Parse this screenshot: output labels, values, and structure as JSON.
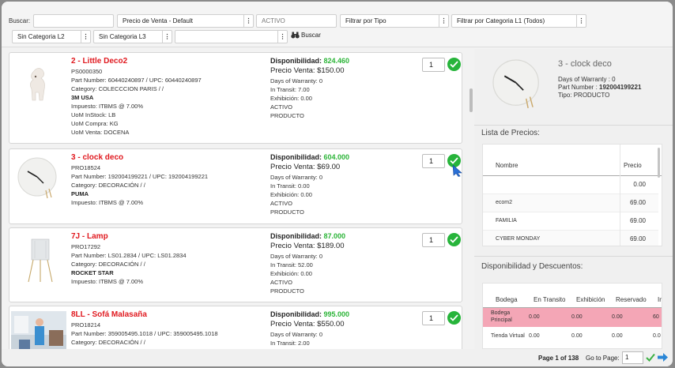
{
  "filters": {
    "search_label": "Buscar:",
    "search_value": "",
    "price_list": "Precio de Venta - Default",
    "status": "ACTIVO",
    "type_filter": "Filtrar por Tipo",
    "category_l1_filter": "Filtrar por Categoria L1 (Todos)",
    "category_l2": "Sin Categoria L2",
    "category_l3": "Sin Categoria L3",
    "extra_select": "",
    "search_button": "Buscar",
    "dots": "⋮"
  },
  "products": [
    {
      "name": "2 - Little Deco2",
      "code": "PS0000350",
      "part_line": "Part Number: 60440240897 / UPC: 60440240897",
      "category": "Category: COLECCCION PARIS / /",
      "brand": "3M USA",
      "tax": "Impuesto: ITBMS @ 7.00%",
      "uom_instock": "UoM InStock: LB",
      "uom_compra": "UoM Compra: KG",
      "uom_venta": "UoM Venta: DOCENA",
      "avail_label": "Disponibilidad:",
      "avail_value": "824.460",
      "price": "Precio Venta: $150.00",
      "warranty": "Days of Warranty: 0",
      "transit": "In Transit: 7.00",
      "exhibit": "Exhibición: 0.00",
      "status": "ACTIVO",
      "type": "PRODUCTO",
      "qty": "1"
    },
    {
      "name": "3 - clock deco",
      "code": "PRO18524",
      "part_line": "Part Number: 192004199221 / UPC: 192004199221",
      "category": "Category: DECORACIÓN / /",
      "brand": "PUMA",
      "tax": "Impuesto: ITBMS @ 7.00%",
      "avail_label": "Disponibilidad:",
      "avail_value": "604.000",
      "price": "Precio Venta: $69.00",
      "warranty": "Days of Warranty: 0",
      "transit": "In Transit: 0.00",
      "exhibit": "Exhibición: 0.00",
      "status": "ACTIVO",
      "type": "PRODUCTO",
      "qty": "1"
    },
    {
      "name": "7J - Lamp",
      "code": "PRO17292",
      "part_line": "Part Number: LS01.2834 / UPC: LS01.2834",
      "category": "Category: DECORACIÓN / /",
      "brand": "ROCKET STAR",
      "tax": "Impuesto: ITBMS @ 7.00%",
      "avail_label": "Disponibilidad:",
      "avail_value": "87.000",
      "price": "Precio Venta: $189.00",
      "warranty": "Days of Warranty: 0",
      "transit": "In Transit: 52.00",
      "exhibit": "Exhibición: 0.00",
      "status": "ACTIVO",
      "type": "PRODUCTO",
      "qty": "1"
    },
    {
      "name": "8LL - Sofá Malasaña",
      "code": "PRO18214",
      "part_line": "Part Number: 359005495.1018 / UPC: 359005495.1018",
      "category": "Category: DECORACIÓN / /",
      "avail_label": "Disponibilidad:",
      "avail_value": "995.000",
      "price": "Precio Venta: $550.00",
      "warranty": "Days of Warranty: 0",
      "transit": "In Transit: 2.00",
      "qty": "1"
    }
  ],
  "detail": {
    "title": "3 - clock deco",
    "warranty": "Days of Warranty : 0",
    "part_label": "Part Number : ",
    "part_value": "192004199221",
    "type": "Tipo: PRODUCTO",
    "price_list_heading": "Lista de Precios:",
    "price_headers": {
      "name": "Nombre",
      "price": "Precio"
    },
    "prices": [
      {
        "name": "",
        "price": "0.00"
      },
      {
        "name": "ecom2",
        "price": "69.00"
      },
      {
        "name": "FAMILIA",
        "price": "69.00"
      },
      {
        "name": "CYBER MONDAY",
        "price": "69.00"
      }
    ],
    "stock_heading": "Disponibilidad y Descuentos:",
    "stock_headers": {
      "warehouse": "Bodega",
      "transit": "En Transito",
      "exhibit": "Exhibición",
      "reserved": "Reservado",
      "more": "In"
    },
    "stock_rows": [
      {
        "warehouse": "Bodega Principal",
        "transit": "0.00",
        "exhibit": "0.00",
        "reserved": "0.00",
        "more": "60"
      },
      {
        "warehouse": "Tienda Virtual",
        "transit": "0.00",
        "exhibit": "0.00",
        "reserved": "0.00",
        "more": "0.0"
      }
    ]
  },
  "pagination": {
    "page_text": "Page 1 of 138",
    "goto_label": "Go to Page:",
    "goto_value": "1"
  },
  "colors": {
    "accent_red": "#e0191f",
    "ok_green": "#27b43b",
    "avail_green": "#2bb437",
    "highlight_row": "#f4a6b6",
    "arrow_blue": "#2a86d6"
  }
}
